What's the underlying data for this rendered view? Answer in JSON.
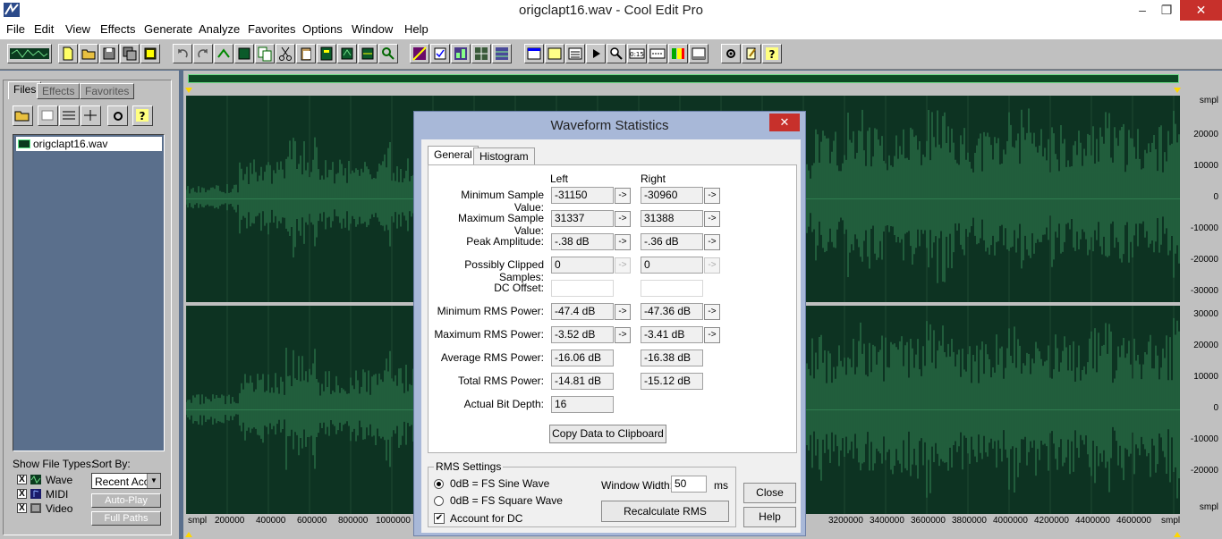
{
  "window": {
    "title": "origclapt16.wav - Cool Edit Pro",
    "minimize": "–",
    "restore": "❐",
    "close": "✕"
  },
  "menu": [
    "File",
    "Edit",
    "View",
    "Effects",
    "Generate",
    "Analyze",
    "Favorites",
    "Options",
    "Window",
    "Help"
  ],
  "organizer": {
    "tabs": [
      "Files",
      "Effects",
      "Favorites"
    ],
    "files": [
      "origclapt16.wav"
    ],
    "show_file_types_label": "Show File Types:",
    "types": [
      {
        "label": "Wave",
        "checked": "X"
      },
      {
        "label": "MIDI",
        "checked": "X"
      },
      {
        "label": "Video",
        "checked": "X"
      }
    ],
    "sort_by_label": "Sort By:",
    "sort_value": "Recent Acc",
    "auto_play": "Auto-Play",
    "full_paths": "Full Paths"
  },
  "scale": {
    "unit": "smpl",
    "top_channel": [
      "20000",
      "10000",
      "0",
      "-10000",
      "-20000",
      "-30000"
    ],
    "bottom_channel": [
      "30000",
      "20000",
      "10000",
      "0",
      "-10000",
      "-20000"
    ],
    "time_ticks": [
      "200000",
      "400000",
      "600000",
      "800000",
      "1000000",
      "3200000",
      "3400000",
      "3600000",
      "3800000",
      "4000000",
      "4200000",
      "4400000",
      "4600000"
    ]
  },
  "dialog": {
    "title": "Waveform Statistics",
    "close_glyph": "✕",
    "tabs": [
      "General",
      "Histogram"
    ],
    "col_left": "Left",
    "col_right": "Right",
    "arrow": "->",
    "rows": [
      {
        "label": "Minimum Sample Value:",
        "left": "-31150",
        "right": "-30960"
      },
      {
        "label": "Maximum Sample Value:",
        "left": "31337",
        "right": "31388"
      },
      {
        "label": "Peak Amplitude:",
        "left": "-.38 dB",
        "right": "-.36 dB"
      },
      {
        "label": "Possibly Clipped Samples:",
        "left": "0",
        "right": "0"
      },
      {
        "label": "DC Offset:",
        "left": "",
        "right": ""
      },
      {
        "label": "Minimum RMS Power:",
        "left": "-47.4 dB",
        "right": "-47.36 dB"
      },
      {
        "label": "Maximum RMS Power:",
        "left": "-3.52 dB",
        "right": "-3.41 dB"
      },
      {
        "label": "Average RMS Power:",
        "left": "-16.06 dB",
        "right": "-16.38 dB"
      },
      {
        "label": "Total RMS Power:",
        "left": "-14.81 dB",
        "right": "-15.12 dB"
      },
      {
        "label": "Actual Bit Depth:",
        "left": "16",
        "right": ""
      }
    ],
    "copy_button": "Copy Data to Clipboard",
    "rms": {
      "group_label": "RMS Settings",
      "sine": "0dB = FS Sine Wave",
      "square": "0dB = FS Square Wave",
      "dc": "Account for DC",
      "dc_check": "✔",
      "window_width_label": "Window Width:",
      "window_width_value": "50",
      "unit": "ms",
      "recalc": "Recalculate RMS"
    },
    "close_button": "Close",
    "help_button": "Help"
  }
}
